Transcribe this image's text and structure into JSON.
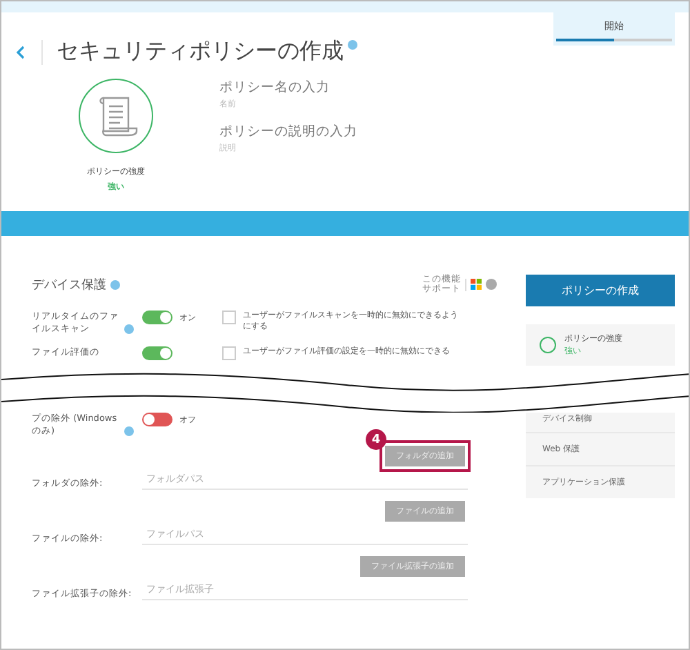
{
  "header": {
    "title": "セキュリティポリシーの作成"
  },
  "progress": {
    "label": "開始",
    "level": 0.5
  },
  "policy_strength": {
    "label": "ポリシーの強度",
    "value": "強い"
  },
  "fields": [
    {
      "label": "ポリシー名の入力",
      "placeholder": "名前"
    },
    {
      "label": "ポリシーの説明の入力",
      "placeholder": "説明"
    }
  ],
  "section": {
    "title": "デバイス保護",
    "support_text": [
      "この機能",
      "サポート"
    ]
  },
  "upper_rows": [
    {
      "label": "リアルタイムのファイルスキャン",
      "on": true,
      "state_text": "オン",
      "checkbox_label": "ユーザーがファイルスキャンを一時的に無効にできるようにする",
      "checked": false
    },
    {
      "label": "ファイル評価の",
      "on": true,
      "checkbox_label": "ユーザーがファイル評価の設定を一時的に無効にできる",
      "checked": false
    }
  ],
  "lower_rows": [
    {
      "label": "プの除外 (Windows のみ)",
      "on": false,
      "state_text": "オフ"
    }
  ],
  "sidebar": {
    "button": "ポリシーの作成",
    "strength_label": "ポリシーの強度",
    "strength_value": "強い",
    "nav_items": [
      "デバイス制御",
      "Web 保護",
      "アプリケーション保護"
    ]
  },
  "exclusions": [
    {
      "label": "フォルダの除外:",
      "placeholder": "フォルダパス",
      "button": "フォルダの追加",
      "highlighted": true,
      "step": "4"
    },
    {
      "label": "ファイルの除外:",
      "placeholder": "ファイルパス",
      "button": "ファイルの追加",
      "highlighted": false
    },
    {
      "label": "ファイル拡張子の除外:",
      "placeholder": "ファイル拡張子",
      "button": "ファイル拡張子の追加",
      "highlighted": false
    }
  ]
}
